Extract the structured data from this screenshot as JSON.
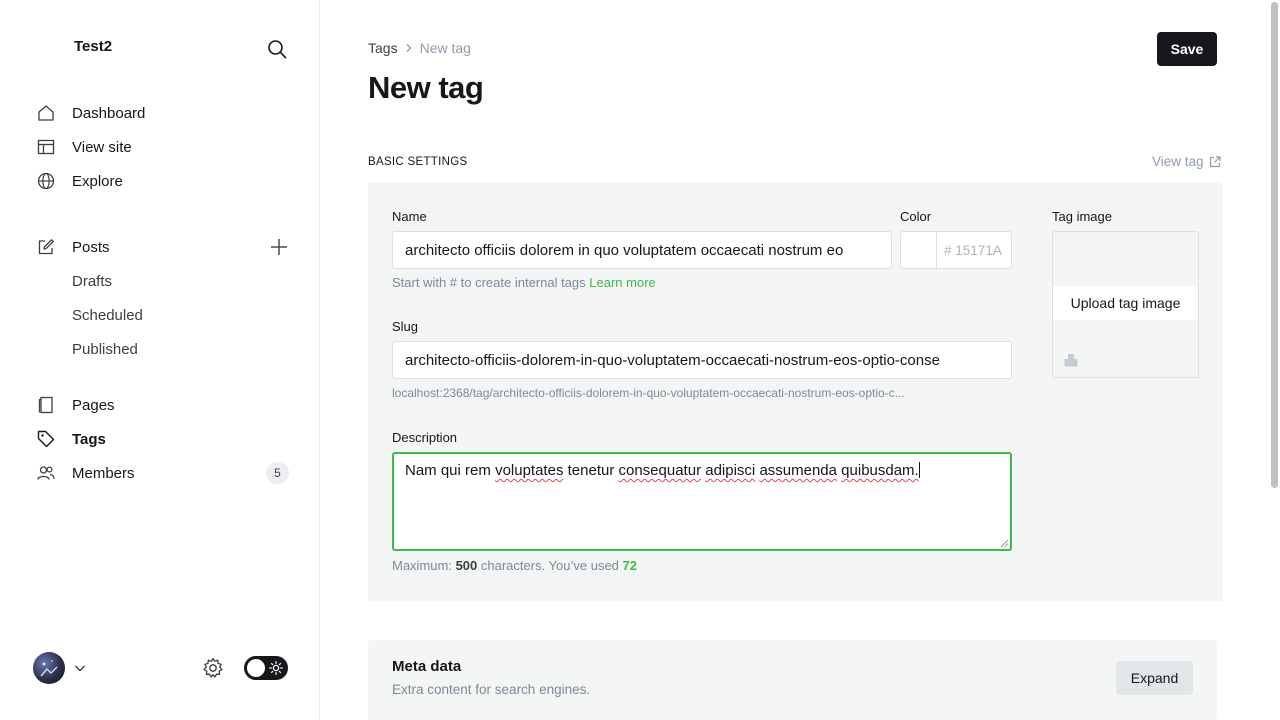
{
  "sidebar": {
    "site_title": "Test2",
    "nav": {
      "dashboard": "Dashboard",
      "view_site": "View site",
      "explore": "Explore",
      "posts": "Posts",
      "drafts": "Drafts",
      "scheduled": "Scheduled",
      "published": "Published",
      "pages": "Pages",
      "tags": "Tags",
      "members": "Members",
      "members_count": "5"
    }
  },
  "header": {
    "breadcrumb_parent": "Tags",
    "breadcrumb_current": "New tag",
    "title": "New tag",
    "save_label": "Save"
  },
  "basic": {
    "section_label": "BASIC SETTINGS",
    "view_tag": "View tag",
    "name_label": "Name",
    "name_value": "architecto officiis dolorem in quo voluptatem occaecati nostrum eo",
    "name_hint": "Start with # to create internal tags",
    "learn_more": "Learn more",
    "color_label": "Color",
    "color_hash": "#",
    "color_placeholder": "15171A",
    "tag_image_label": "Tag image",
    "upload_label": "Upload tag image",
    "slug_label": "Slug",
    "slug_value": "architecto-officiis-dolorem-in-quo-voluptatem-occaecati-nostrum-eos-optio-conse",
    "slug_url": "localhost:2368/tag/architecto-officiis-dolorem-in-quo-voluptatem-occaecati-nostrum-eos-optio-c...",
    "description_label": "Description",
    "description_words": [
      "Nam",
      "qui",
      "rem",
      "voluptates",
      "tenetur",
      "consequatur",
      "adipisci",
      "assumenda",
      "quibusdam."
    ],
    "desc_hint_prefix": "Maximum: ",
    "desc_max": "500",
    "desc_hint_mid": " characters. You’ve used ",
    "desc_used": "72"
  },
  "meta": {
    "title": "Meta data",
    "subtitle": "Extra content for search engines.",
    "expand_label": "Expand"
  },
  "colors": {
    "accent_green": "#3eb94e",
    "dark": "#15171a",
    "panel": "#f4f5f5"
  }
}
